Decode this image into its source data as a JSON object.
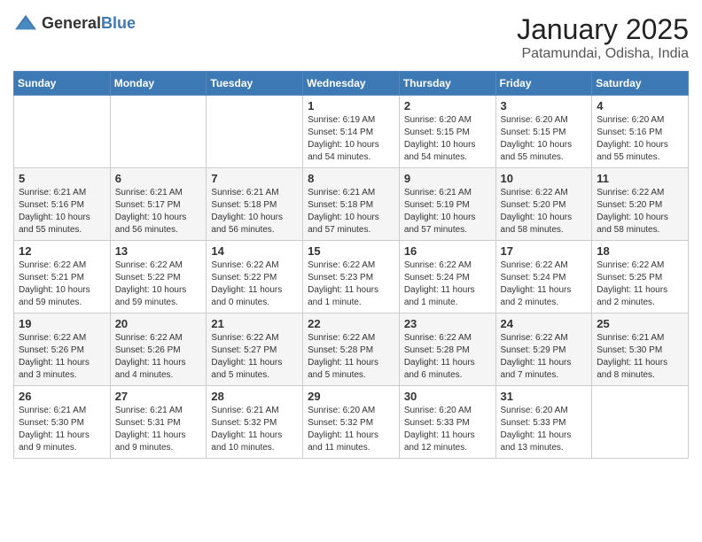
{
  "header": {
    "logo_general": "General",
    "logo_blue": "Blue",
    "title": "January 2025",
    "location": "Patamundai, Odisha, India"
  },
  "days_of_week": [
    "Sunday",
    "Monday",
    "Tuesday",
    "Wednesday",
    "Thursday",
    "Friday",
    "Saturday"
  ],
  "weeks": [
    [
      {
        "day": "",
        "info": ""
      },
      {
        "day": "",
        "info": ""
      },
      {
        "day": "",
        "info": ""
      },
      {
        "day": "1",
        "info": "Sunrise: 6:19 AM\nSunset: 5:14 PM\nDaylight: 10 hours\nand 54 minutes."
      },
      {
        "day": "2",
        "info": "Sunrise: 6:20 AM\nSunset: 5:15 PM\nDaylight: 10 hours\nand 54 minutes."
      },
      {
        "day": "3",
        "info": "Sunrise: 6:20 AM\nSunset: 5:15 PM\nDaylight: 10 hours\nand 55 minutes."
      },
      {
        "day": "4",
        "info": "Sunrise: 6:20 AM\nSunset: 5:16 PM\nDaylight: 10 hours\nand 55 minutes."
      }
    ],
    [
      {
        "day": "5",
        "info": "Sunrise: 6:21 AM\nSunset: 5:16 PM\nDaylight: 10 hours\nand 55 minutes."
      },
      {
        "day": "6",
        "info": "Sunrise: 6:21 AM\nSunset: 5:17 PM\nDaylight: 10 hours\nand 56 minutes."
      },
      {
        "day": "7",
        "info": "Sunrise: 6:21 AM\nSunset: 5:18 PM\nDaylight: 10 hours\nand 56 minutes."
      },
      {
        "day": "8",
        "info": "Sunrise: 6:21 AM\nSunset: 5:18 PM\nDaylight: 10 hours\nand 57 minutes."
      },
      {
        "day": "9",
        "info": "Sunrise: 6:21 AM\nSunset: 5:19 PM\nDaylight: 10 hours\nand 57 minutes."
      },
      {
        "day": "10",
        "info": "Sunrise: 6:22 AM\nSunset: 5:20 PM\nDaylight: 10 hours\nand 58 minutes."
      },
      {
        "day": "11",
        "info": "Sunrise: 6:22 AM\nSunset: 5:20 PM\nDaylight: 10 hours\nand 58 minutes."
      }
    ],
    [
      {
        "day": "12",
        "info": "Sunrise: 6:22 AM\nSunset: 5:21 PM\nDaylight: 10 hours\nand 59 minutes."
      },
      {
        "day": "13",
        "info": "Sunrise: 6:22 AM\nSunset: 5:22 PM\nDaylight: 10 hours\nand 59 minutes."
      },
      {
        "day": "14",
        "info": "Sunrise: 6:22 AM\nSunset: 5:22 PM\nDaylight: 11 hours\nand 0 minutes."
      },
      {
        "day": "15",
        "info": "Sunrise: 6:22 AM\nSunset: 5:23 PM\nDaylight: 11 hours\nand 1 minute."
      },
      {
        "day": "16",
        "info": "Sunrise: 6:22 AM\nSunset: 5:24 PM\nDaylight: 11 hours\nand 1 minute."
      },
      {
        "day": "17",
        "info": "Sunrise: 6:22 AM\nSunset: 5:24 PM\nDaylight: 11 hours\nand 2 minutes."
      },
      {
        "day": "18",
        "info": "Sunrise: 6:22 AM\nSunset: 5:25 PM\nDaylight: 11 hours\nand 2 minutes."
      }
    ],
    [
      {
        "day": "19",
        "info": "Sunrise: 6:22 AM\nSunset: 5:26 PM\nDaylight: 11 hours\nand 3 minutes."
      },
      {
        "day": "20",
        "info": "Sunrise: 6:22 AM\nSunset: 5:26 PM\nDaylight: 11 hours\nand 4 minutes."
      },
      {
        "day": "21",
        "info": "Sunrise: 6:22 AM\nSunset: 5:27 PM\nDaylight: 11 hours\nand 5 minutes."
      },
      {
        "day": "22",
        "info": "Sunrise: 6:22 AM\nSunset: 5:28 PM\nDaylight: 11 hours\nand 5 minutes."
      },
      {
        "day": "23",
        "info": "Sunrise: 6:22 AM\nSunset: 5:28 PM\nDaylight: 11 hours\nand 6 minutes."
      },
      {
        "day": "24",
        "info": "Sunrise: 6:22 AM\nSunset: 5:29 PM\nDaylight: 11 hours\nand 7 minutes."
      },
      {
        "day": "25",
        "info": "Sunrise: 6:21 AM\nSunset: 5:30 PM\nDaylight: 11 hours\nand 8 minutes."
      }
    ],
    [
      {
        "day": "26",
        "info": "Sunrise: 6:21 AM\nSunset: 5:30 PM\nDaylight: 11 hours\nand 9 minutes."
      },
      {
        "day": "27",
        "info": "Sunrise: 6:21 AM\nSunset: 5:31 PM\nDaylight: 11 hours\nand 9 minutes."
      },
      {
        "day": "28",
        "info": "Sunrise: 6:21 AM\nSunset: 5:32 PM\nDaylight: 11 hours\nand 10 minutes."
      },
      {
        "day": "29",
        "info": "Sunrise: 6:20 AM\nSunset: 5:32 PM\nDaylight: 11 hours\nand 11 minutes."
      },
      {
        "day": "30",
        "info": "Sunrise: 6:20 AM\nSunset: 5:33 PM\nDaylight: 11 hours\nand 12 minutes."
      },
      {
        "day": "31",
        "info": "Sunrise: 6:20 AM\nSunset: 5:33 PM\nDaylight: 11 hours\nand 13 minutes."
      },
      {
        "day": "",
        "info": ""
      }
    ]
  ]
}
